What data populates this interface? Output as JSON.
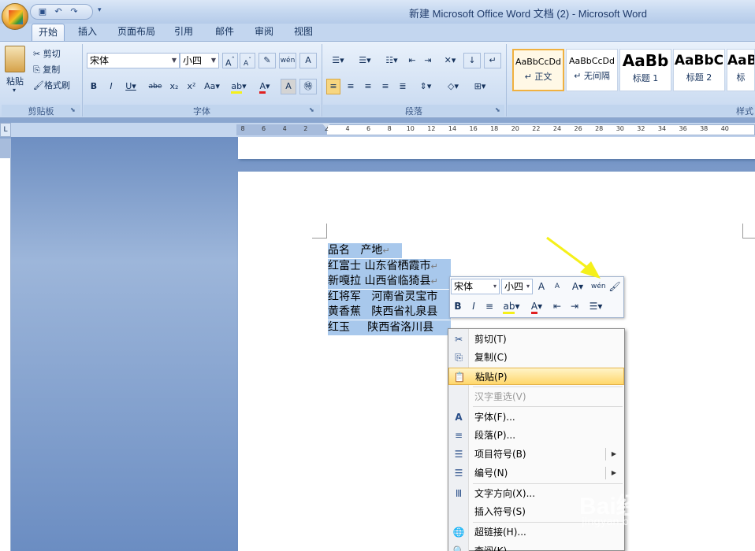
{
  "window": {
    "title": "新建 Microsoft Office Word 文档 (2) - Microsoft Word"
  },
  "qat": {
    "icons": [
      "save-icon",
      "undo-icon",
      "redo-icon"
    ],
    "more": "▾"
  },
  "tabs": [
    "开始",
    "插入",
    "页面布局",
    "引用",
    "邮件",
    "审阅",
    "视图"
  ],
  "clipboard": {
    "paste": "粘贴",
    "cut": "剪切",
    "copy": "复制",
    "format_painter": "格式刷",
    "group": "剪贴板"
  },
  "font": {
    "name": "宋体",
    "size": "小四",
    "group": "字体"
  },
  "paragraph": {
    "group": "段落"
  },
  "styles": {
    "items": [
      {
        "sample": "AaBbCcDd",
        "name": "↵ 正文"
      },
      {
        "sample": "AaBbCcDd",
        "name": "↵ 无间隔"
      },
      {
        "sample": "AaBb",
        "name": "标题 1"
      },
      {
        "sample": "AaBbC",
        "name": "标题 2"
      },
      {
        "sample": "AaB",
        "name": "标"
      }
    ],
    "group": "样式"
  },
  "ruler": {
    "numbers": [
      "8",
      "6",
      "4",
      "2",
      "2",
      "4",
      "6",
      "8",
      "10",
      "12",
      "14",
      "16",
      "18",
      "20",
      "22",
      "24",
      "26",
      "28",
      "30",
      "32",
      "34",
      "36",
      "38",
      "40"
    ]
  },
  "document": {
    "lines": [
      {
        "a": "品名",
        "b": "产地",
        "pad": " "
      },
      {
        "a": "红富士",
        "b": "山东省栖霞市",
        "pad": " "
      },
      {
        "a": "新嘎拉",
        "b": "山西省临猗县",
        "pad": " "
      },
      {
        "a": "红将军",
        "b": "河南省灵宝市",
        "pad": "   "
      },
      {
        "a": "黄香蕉",
        "b": "陕西省礼泉县",
        "pad": "   "
      },
      {
        "a": "红玉",
        "b": "陕西省洛川县",
        "pad": "     "
      }
    ],
    "para_mark": "↵"
  },
  "mini_toolbar": {
    "font": "宋体",
    "size": "小四"
  },
  "context_menu": {
    "items": [
      {
        "label": "剪切(T)",
        "icon": "cut-icon",
        "glyph": "✂"
      },
      {
        "label": "复制(C)",
        "icon": "copy-icon",
        "glyph": "⎘"
      },
      {
        "label": "粘贴(P)",
        "icon": "paste-icon",
        "glyph": "📋"
      },
      {
        "label": "汉字重选(V)",
        "icon": "",
        "glyph": ""
      },
      {
        "label": "字体(F)...",
        "icon": "font-icon",
        "glyph": "A"
      },
      {
        "label": "段落(P)...",
        "icon": "paragraph-icon",
        "glyph": "≡"
      },
      {
        "label": "项目符号(B)",
        "icon": "bullets-icon",
        "glyph": "☰"
      },
      {
        "label": "编号(N)",
        "icon": "numbering-icon",
        "glyph": "☰"
      },
      {
        "label": "文字方向(X)...",
        "icon": "text-direction-icon",
        "glyph": "Ⅲ"
      },
      {
        "label": "插入符号(S)",
        "icon": "",
        "glyph": ""
      },
      {
        "label": "超链接(H)...",
        "icon": "hyperlink-icon",
        "glyph": "🌐"
      },
      {
        "label": "查阅(K)...",
        "icon": "lookup-icon",
        "glyph": "🔍"
      }
    ],
    "submenu_arrow": "▶"
  },
  "watermark": {
    "text": "Bai经验",
    "sub": "jingyan.baidu.com"
  },
  "colors": {
    "accent": "#f0b140",
    "highlight_arrow": "#f5f01a",
    "selection": "#a8c8ec"
  }
}
